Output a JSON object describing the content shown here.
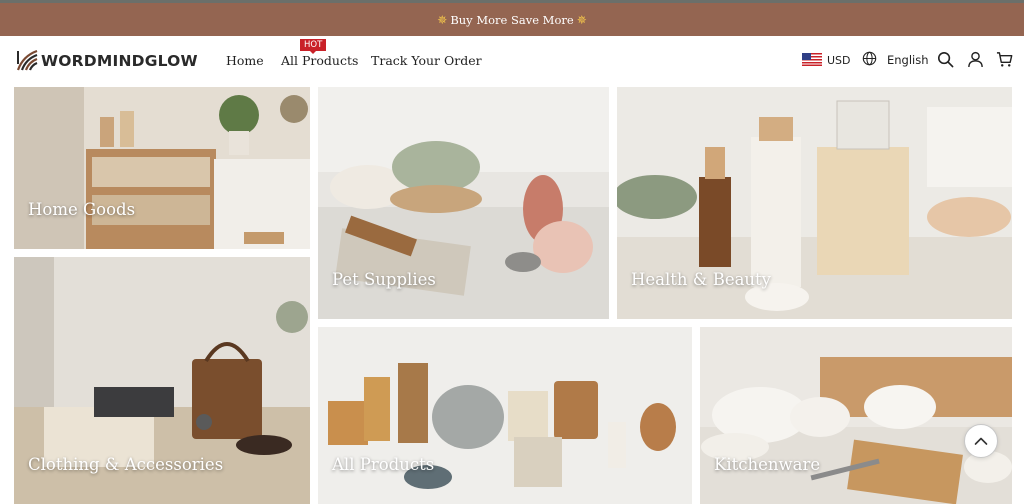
{
  "announcement": {
    "text": "Buy More Save More",
    "star_left": "✵",
    "star_right": "✵"
  },
  "brand": {
    "name": "WORDMINDGLOW"
  },
  "nav": {
    "items": [
      {
        "label": "Home"
      },
      {
        "label": "All Products",
        "badge": "HOT"
      },
      {
        "label": "Track Your Order"
      }
    ]
  },
  "tools": {
    "currency": "USD",
    "language": "English",
    "icons": [
      "us-flag-icon",
      "globe-icon",
      "search-icon",
      "account-icon",
      "cart-icon"
    ]
  },
  "categories": [
    {
      "label": "Home Goods"
    },
    {
      "label": "Pet Supplies"
    },
    {
      "label": "Health & Beauty"
    },
    {
      "label": "Clothing & Accessories"
    },
    {
      "label": "All Products"
    },
    {
      "label": "Kitchenware"
    }
  ],
  "colors": {
    "announcement_bar": "#946551",
    "hot_badge": "#c92128",
    "accent_gold": "#f4c64b"
  }
}
